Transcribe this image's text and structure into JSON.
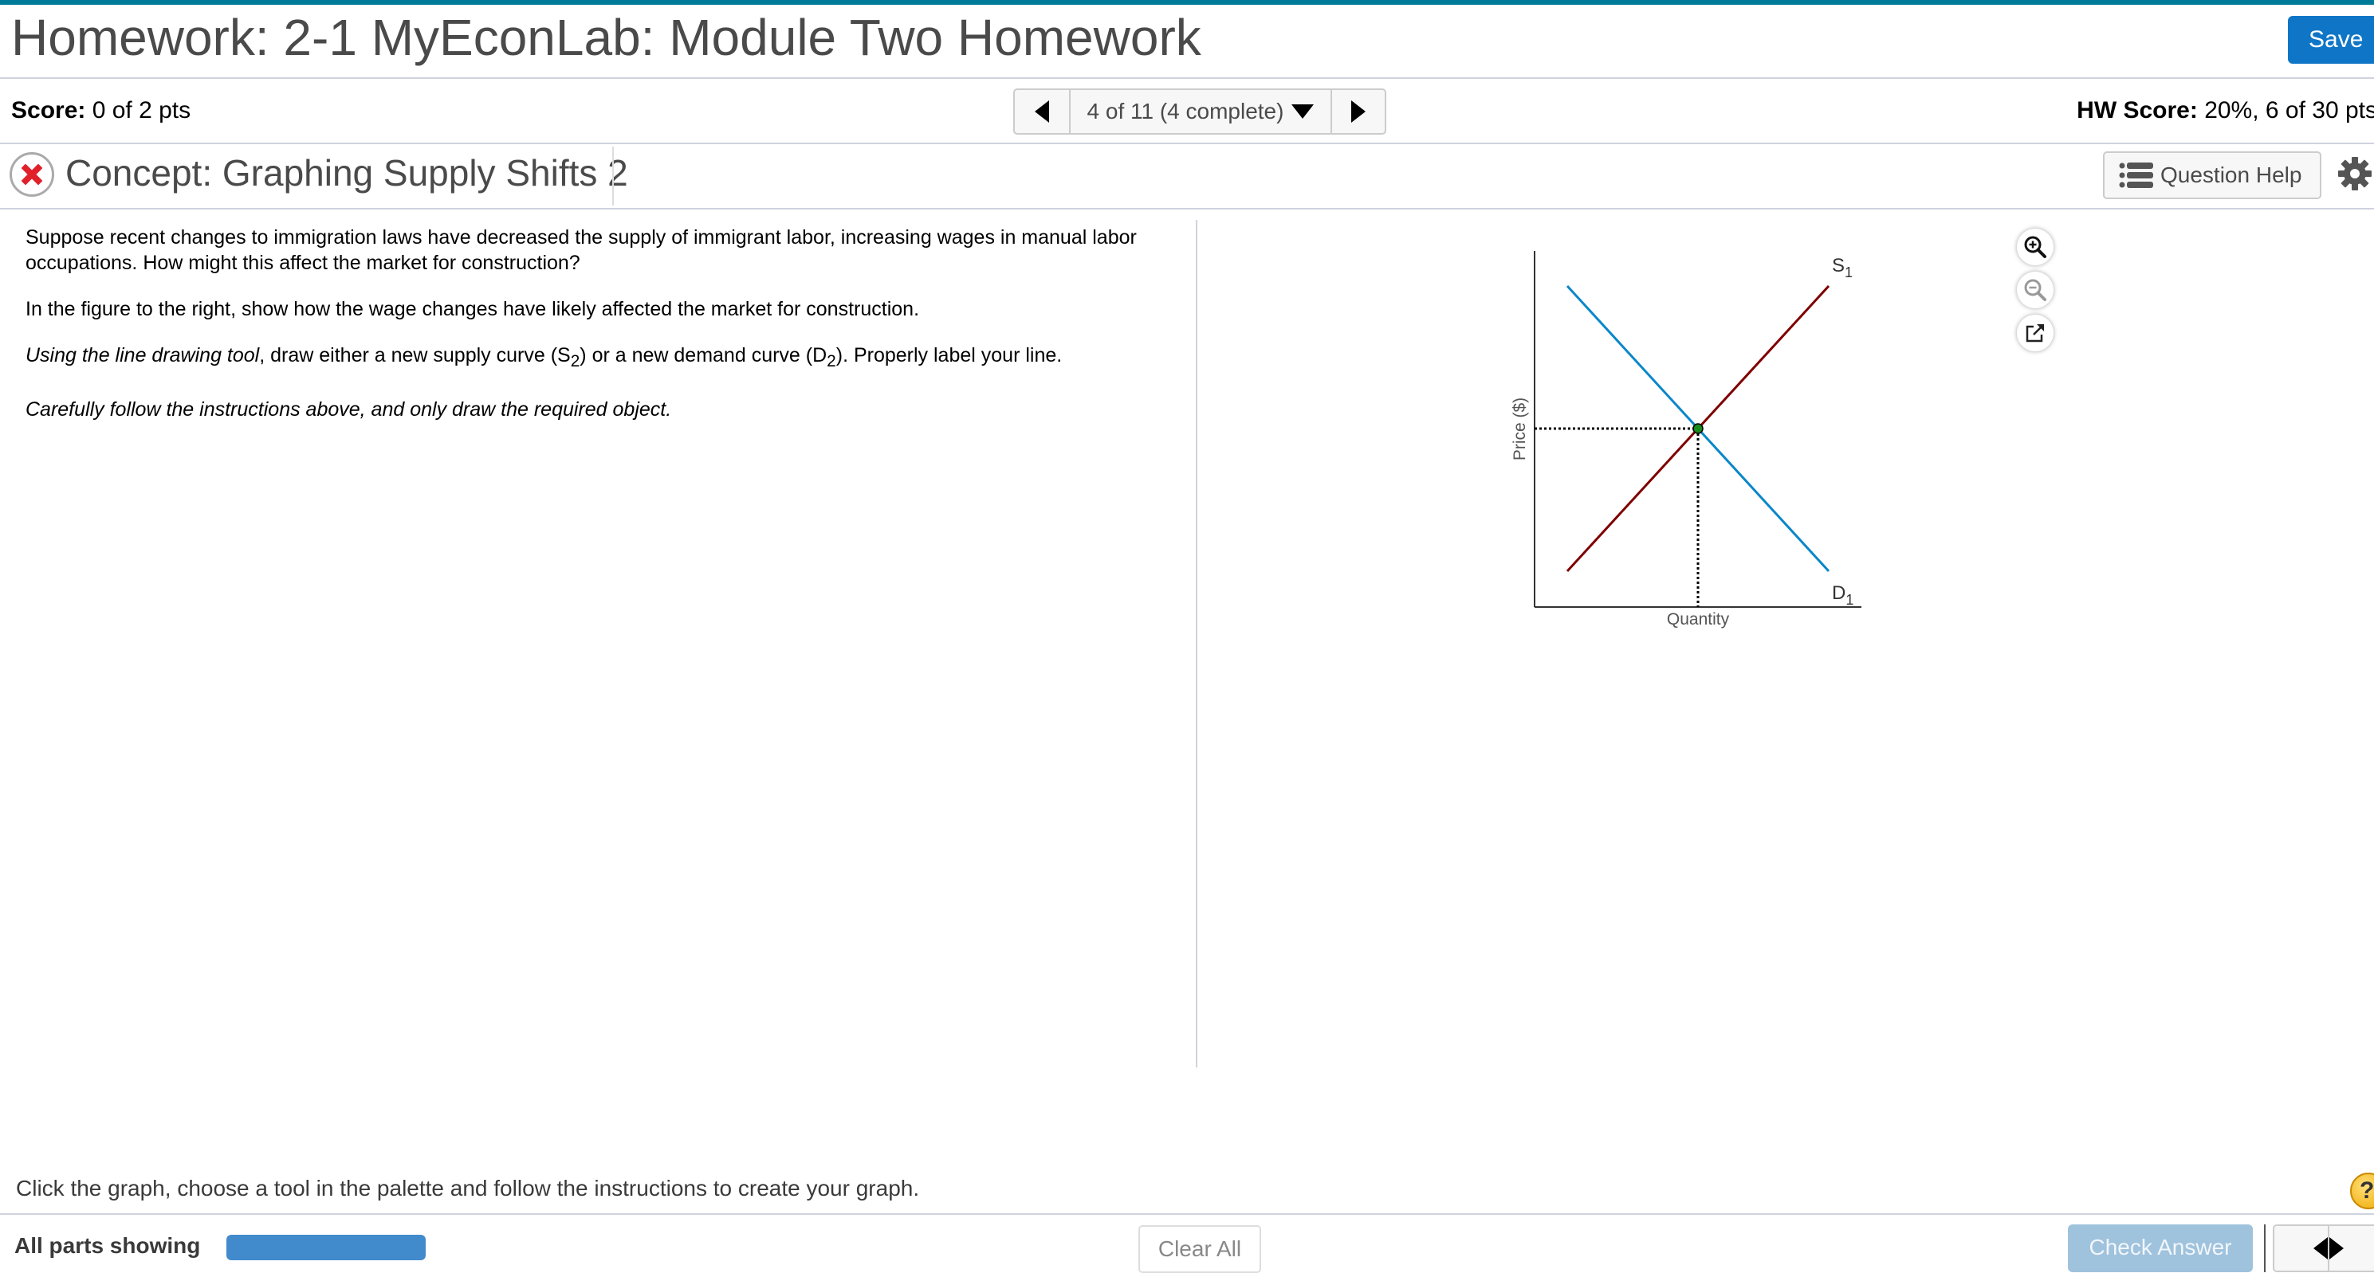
{
  "header": {
    "title": "Homework: 2-1 MyEconLab: Module Two Homework",
    "save_label": "Save",
    "brand_color": "#007a99",
    "save_color": "#0f76c7"
  },
  "score_bar": {
    "score_label": "Score:",
    "score_value": "0 of 2 pts",
    "navigator_text": "4 of 11 (4 complete)",
    "hw_score_label": "HW Score:",
    "hw_score_value": "20%, 6 of 30 pts"
  },
  "question_header": {
    "status_icon": "x-mark-icon",
    "title": "Concept: Graphing Supply Shifts 2",
    "help_label": "Question Help"
  },
  "question": {
    "p1": "Suppose recent changes to immigration laws have decreased the supply of immigrant labor, increasing wages in manual labor occupations.  How might this affect the market for construction?",
    "p1_line1": "Suppose recent changes to immigration laws have decreased the supply of immigrant labor, increasing wages in manual labor",
    "p1_line2": "occupations.  How might this affect the market for construction?",
    "p2": "In the figure to the right, show how the wage changes have likely affected the market for construction.",
    "p3_italic": "Using the line drawing tool",
    "p3_a": ", draw either a new supply curve (S",
    "p3_sub1": "2",
    "p3_b": ") or a new demand curve (D",
    "p3_sub2": "2",
    "p3_c": "). Properly label your line.",
    "p4": "Carefully follow the instructions above, and only draw the required object."
  },
  "graph_tools": {
    "zoom_in": "zoom-in-icon",
    "zoom_out": "zoom-out-icon",
    "popout": "external-link-icon"
  },
  "chart_data": {
    "type": "line",
    "title": "",
    "xlabel": "Quantity",
    "ylabel": "Price ($)",
    "xlim": [
      0,
      10
    ],
    "ylim": [
      0,
      10
    ],
    "grid": false,
    "series": [
      {
        "name": "D1",
        "label": "D",
        "sub": "1",
        "color": "#0a87c9",
        "points": [
          [
            1,
            9
          ],
          [
            9,
            1
          ]
        ]
      },
      {
        "name": "S1",
        "label": "S",
        "sub": "1",
        "color": "#7f0000",
        "points": [
          [
            1,
            1
          ],
          [
            9,
            9
          ]
        ]
      }
    ],
    "equilibrium": {
      "x": 5,
      "y": 5,
      "color": "#1a8a1a"
    }
  },
  "footer": {
    "instruction": "Click the graph, choose a tool in the palette and follow the instructions to create your graph.",
    "all_parts_label": "All parts showing",
    "progress_fraction": 1.0,
    "clear_all_label": "Clear All",
    "check_answer_label": "Check Answer",
    "help_symbol": "?"
  }
}
